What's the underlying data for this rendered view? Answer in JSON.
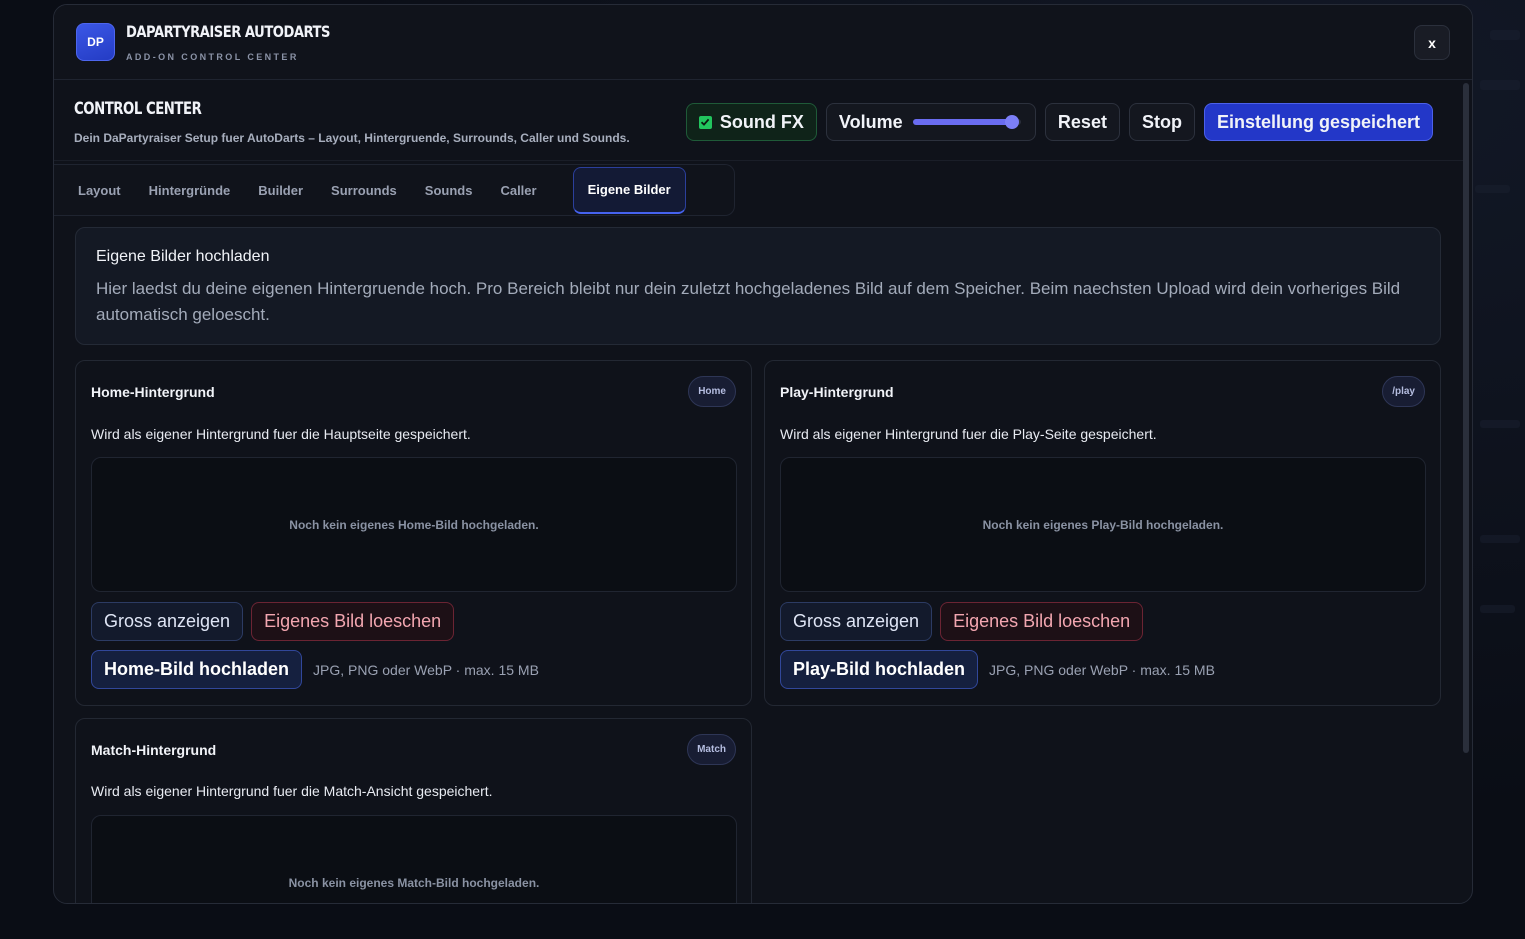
{
  "header": {
    "logo_text": "DP",
    "title": "DAPARTYRAISER AUTODARTS",
    "subtitle": "ADD-ON CONTROL CENTER",
    "close_label": "x"
  },
  "control_bar": {
    "title": "CONTROL CENTER",
    "description": "Dein DaPartyraiser Setup fuer AutoDarts – Layout, Hintergruende, Surrounds, Caller und Sounds.",
    "sound_fx_label": "Sound FX",
    "sound_fx_checked": true,
    "volume_label": "Volume",
    "volume_level": 0.92,
    "reset_label": "Reset",
    "stop_label": "Stop",
    "save_label": "Einstellung gespeichert"
  },
  "tabs": [
    {
      "label": "Layout"
    },
    {
      "label": "Hintergründe"
    },
    {
      "label": "Builder"
    },
    {
      "label": "Surrounds"
    },
    {
      "label": "Sounds"
    },
    {
      "label": "Caller"
    },
    {
      "label": "Eigene Bilder",
      "active": true
    }
  ],
  "info": {
    "title": "Eigene Bilder hochladen",
    "text": "Hier laedst du deine eigenen Hintergruende hoch. Pro Bereich bleibt nur dein zuletzt hochgeladenes Bild auf dem Speicher. Beim naechsten Upload wird dein vorheriges Bild automatisch geloescht."
  },
  "cards": {
    "home": {
      "title": "Home-Hintergrund",
      "tag": "Home",
      "description": "Wird als eigener Hintergrund fuer die Hauptseite gespeichert.",
      "empty_text": "Noch kein eigenes Home-Bild hochgeladen.",
      "show_label": "Gross anzeigen",
      "delete_label": "Eigenes Bild loeschen",
      "upload_label": "Home-Bild hochladen",
      "hint": "JPG, PNG oder WebP · max. 15 MB"
    },
    "play": {
      "title": "Play-Hintergrund",
      "tag": "/play",
      "description": "Wird als eigener Hintergrund fuer die Play-Seite gespeichert.",
      "empty_text": "Noch kein eigenes Play-Bild hochgeladen.",
      "show_label": "Gross anzeigen",
      "delete_label": "Eigenes Bild loeschen",
      "upload_label": "Play-Bild hochladen",
      "hint": "JPG, PNG oder WebP · max. 15 MB"
    },
    "match": {
      "title": "Match-Hintergrund",
      "tag": "Match",
      "description": "Wird als eigener Hintergrund fuer die Match-Ansicht gespeichert.",
      "empty_text": "Noch kein eigenes Match-Bild hochgeladen."
    }
  },
  "colors": {
    "accent": "#2337c8",
    "success": "#22c55e",
    "danger": "#6b2433"
  }
}
